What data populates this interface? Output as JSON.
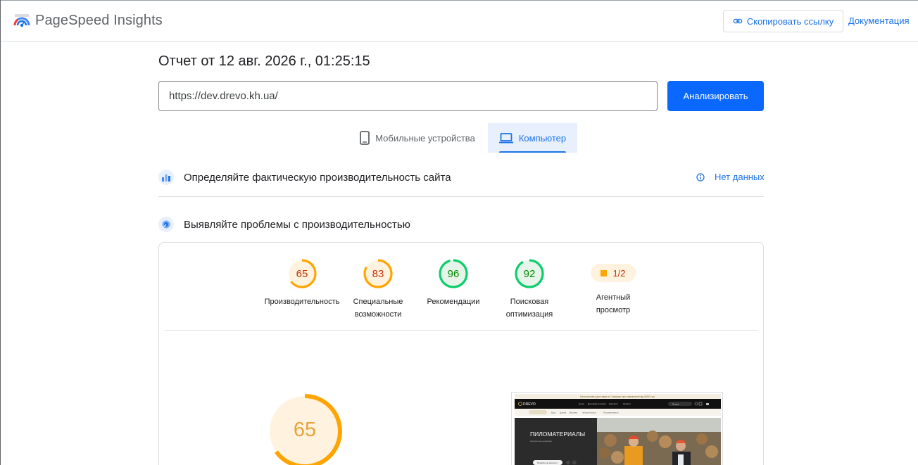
{
  "header": {
    "brand": "PageSpeed Insights",
    "copy_link": "Скопировать ссылку",
    "docs": "Документация"
  },
  "report": {
    "title": "Отчет от 12 авг. 2026 г., 01:25:15",
    "url_value": "https://dev.drevo.kh.ua/",
    "analyze_button": "Анализировать"
  },
  "tabs": {
    "mobile": "Мобильные устройства",
    "desktop": "Компьютер",
    "selected": "desktop"
  },
  "field_data": {
    "title": "Определяйте фактическую производительность сайта",
    "status": "Нет данных"
  },
  "lab_data": {
    "title": "Выявляйте проблемы с производительностью"
  },
  "scores": [
    {
      "label_line1": "Производительность",
      "label_line2": "",
      "score": 65,
      "level": "average",
      "color": "#ffa400",
      "bg": "#fff3e0",
      "text_color": "#c33300"
    },
    {
      "label_line1": "Специальные",
      "label_line2": "возможности",
      "score": 83,
      "level": "average",
      "color": "#ffa400",
      "bg": "#fff3e0",
      "text_color": "#c33300"
    },
    {
      "label_line1": "Рекомендации",
      "label_line2": "",
      "score": 96,
      "level": "pass",
      "color": "#0cce6b",
      "bg": "#e6f4ea",
      "text_color": "#008800"
    },
    {
      "label_line1": "Поисковая",
      "label_line2": "оптимизация",
      "score": 92,
      "level": "pass",
      "color": "#0cce6b",
      "bg": "#e6f4ea",
      "text_color": "#008800"
    }
  ],
  "agent": {
    "label_line1": "Агентный",
    "label_line2": "просмотр",
    "value": "1/2",
    "color": "#ffa400"
  },
  "performance_big": {
    "score": 65,
    "color": "#ffa400",
    "text_color": "#e8a23a"
  },
  "screenshot": {
    "banner_text": "Безкоштовна доставка по Харкову при замовленні від 5000 грн",
    "logo": "DREVO",
    "nav": [
      "Home",
      "Доставка й оплата",
      "Контакти",
      "Каталог"
    ],
    "hero_title": "ПИЛОМАТЕРИАЛЫ",
    "hero_subtitle": "Натуральна деревина",
    "search_label": "Пошук",
    "categories": [
      "Брус",
      "Дошка",
      "Вагонка",
      "Імітація бруса",
      "Пиломатеріали"
    ],
    "button": "Перейти до каталогу"
  }
}
